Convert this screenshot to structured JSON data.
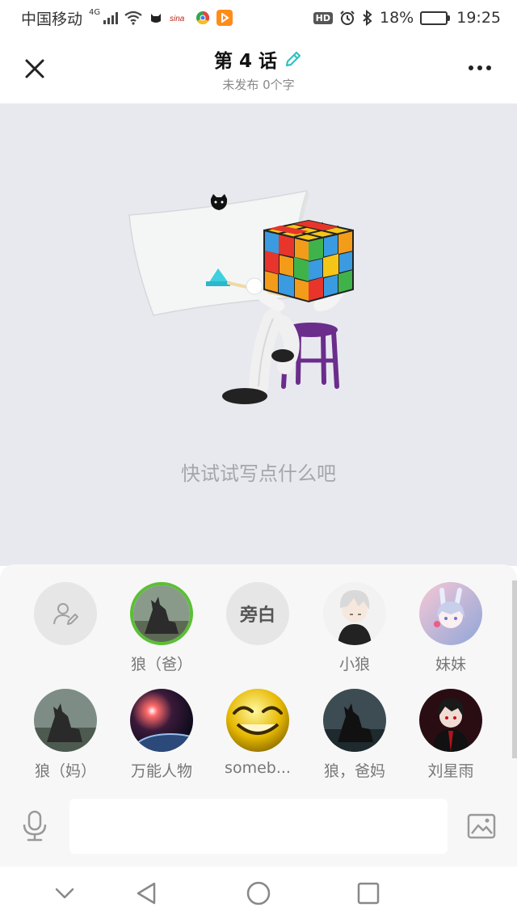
{
  "status_bar": {
    "carrier": "中国移动",
    "network": "4G",
    "hd": "HD",
    "battery_percent": "18%",
    "battery_level": 0.18,
    "time": "19:25",
    "icons": [
      "signal-icon",
      "wifi-icon",
      "app-cat-icon",
      "sina-icon",
      "app-chrome-icon",
      "play-icon",
      "alarm-icon",
      "bluetooth-icon"
    ]
  },
  "header": {
    "title": "第 4 话",
    "subtitle": "未发布 0个字",
    "close_icon": "close-icon",
    "edit_icon": "pencil-icon",
    "more_icon": "more-icon"
  },
  "canvas": {
    "empty_hint": "快试试写点什么吧",
    "illustration": "rubiks-cube-figure-painting"
  },
  "characters": [
    {
      "label": "",
      "type": "add",
      "icon": "person-edit-icon"
    },
    {
      "label": "狼（爸）",
      "type": "avatar",
      "selected": true,
      "theme": "wolf-green"
    },
    {
      "label": "",
      "type": "narration",
      "text": "旁白"
    },
    {
      "label": "小狼",
      "type": "avatar",
      "theme": "boy"
    },
    {
      "label": "妹妹",
      "type": "avatar",
      "theme": "girl"
    },
    {
      "label": "狼（妈）",
      "type": "avatar",
      "theme": "wolf-gray"
    },
    {
      "label": "万能人物",
      "type": "avatar",
      "theme": "space"
    },
    {
      "label": "someb...",
      "type": "avatar",
      "theme": "smile"
    },
    {
      "label": "狼，爸妈",
      "type": "avatar",
      "theme": "wolf-dark"
    },
    {
      "label": "刘星雨",
      "type": "avatar",
      "theme": "red-dark"
    }
  ],
  "input_bar": {
    "placeholder": "",
    "mic_icon": "microphone-icon",
    "image_icon": "image-icon"
  },
  "nav_bar": {
    "icons": [
      "collapse-icon",
      "back-icon",
      "home-icon",
      "recents-icon"
    ]
  },
  "colors": {
    "accent_green": "#5bbf36",
    "canvas_bg": "#e8e9ee",
    "hint_text": "#a5a6ab",
    "battery": "#f5a623"
  }
}
